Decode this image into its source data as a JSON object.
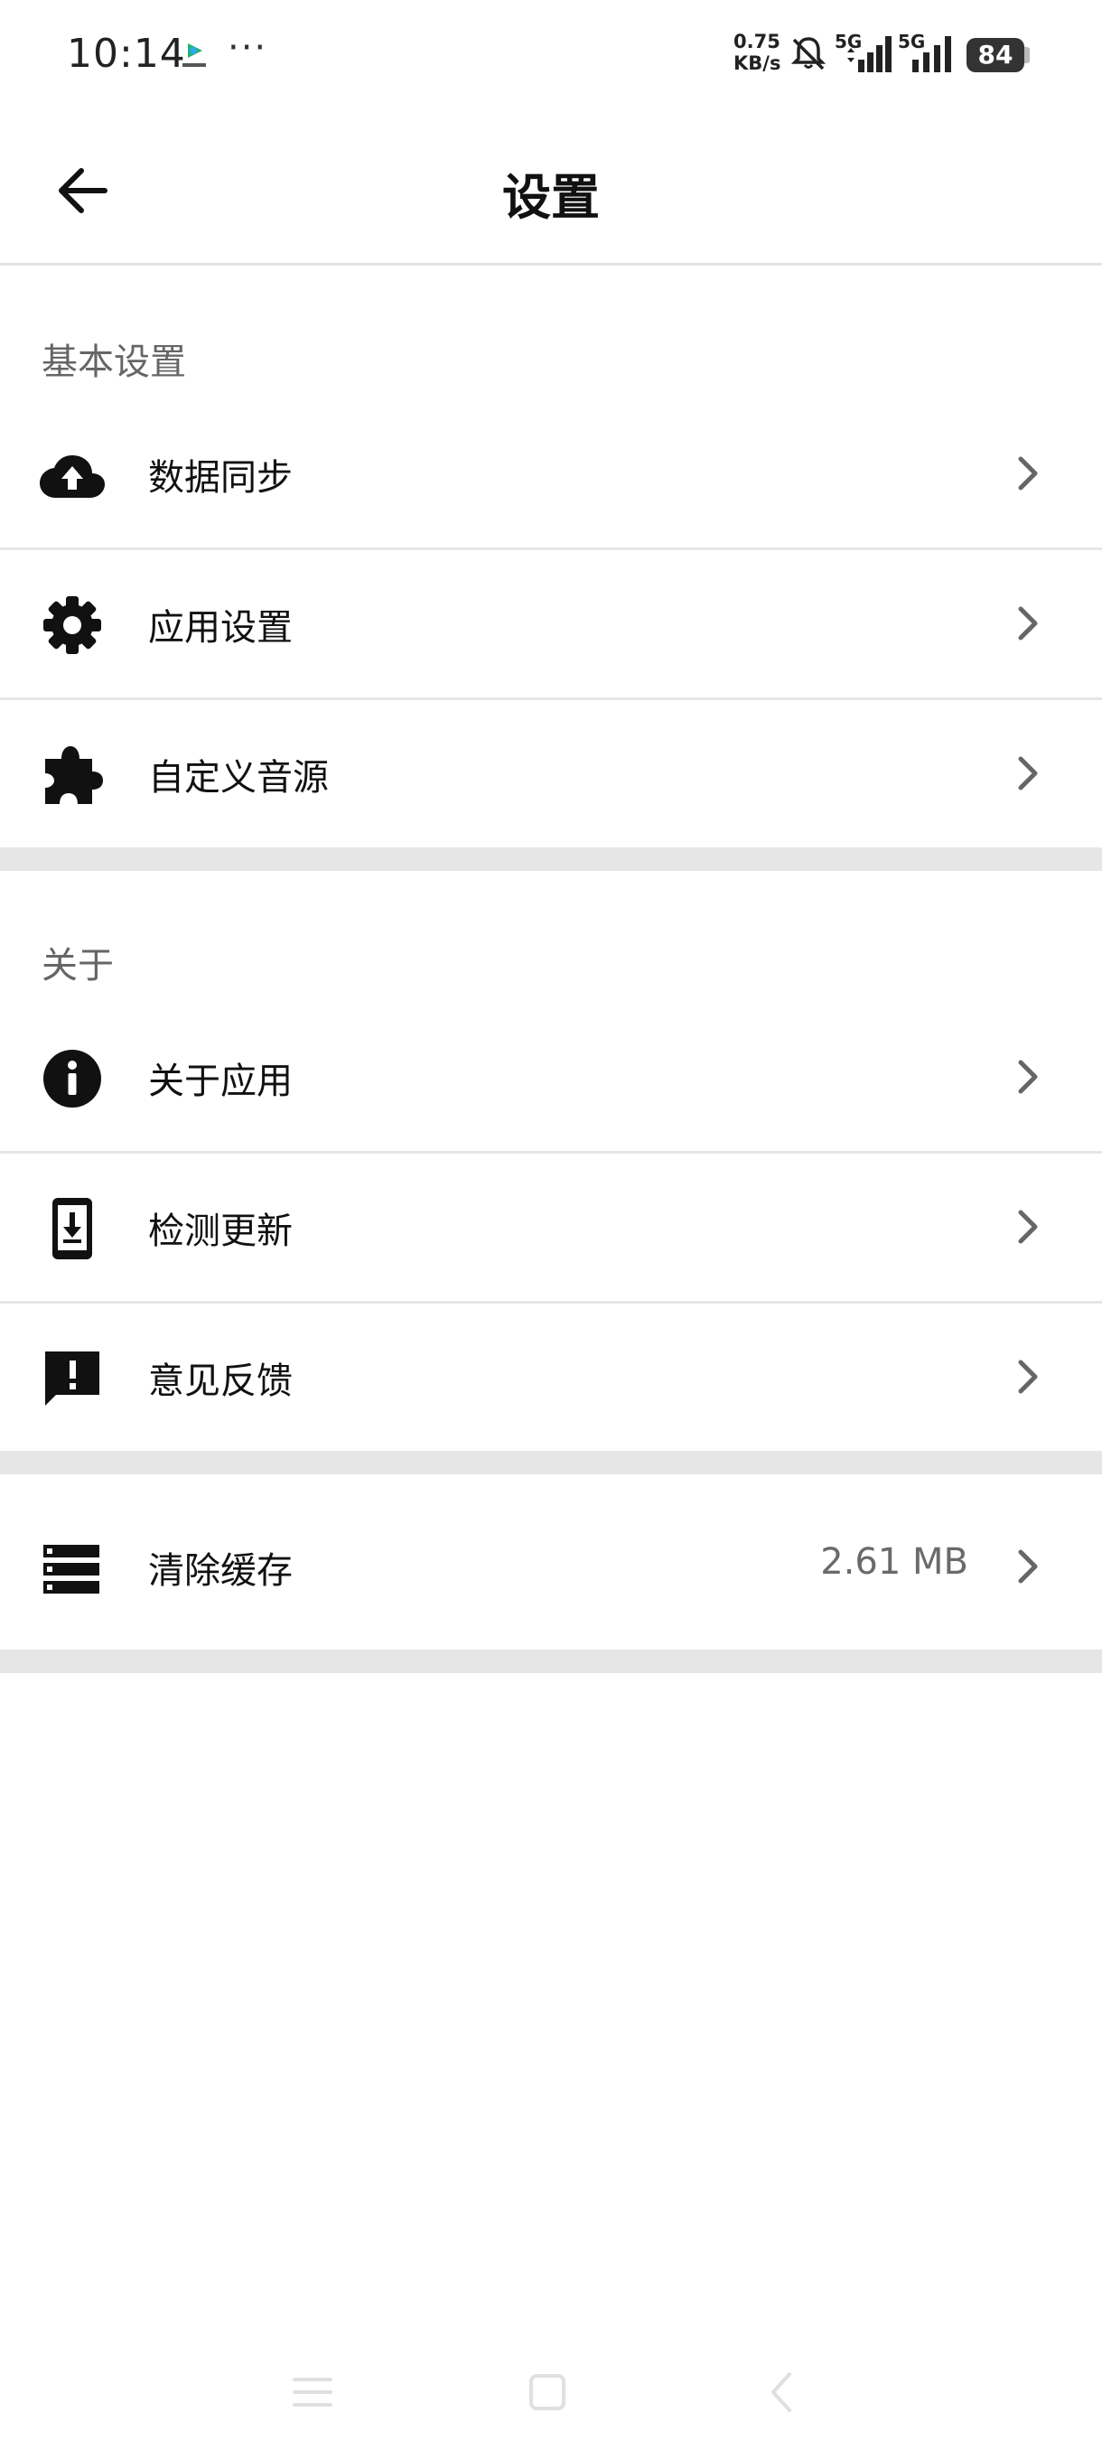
{
  "status_bar": {
    "time": "10:14",
    "more": "···",
    "net_speed_value": "0.75",
    "net_speed_unit": "KB/s",
    "signal1_label": "5G",
    "signal2_label": "5G",
    "battery": "84",
    "icons": [
      "app-notification-icon",
      "bell-muted-icon",
      "signal-icon",
      "signal-icon",
      "battery-icon"
    ]
  },
  "header": {
    "title": "设置",
    "back_icon": "arrow-left-icon"
  },
  "sections": {
    "basic": {
      "label": "基本设置",
      "items": [
        {
          "label": "数据同步",
          "icon": "cloud-upload-icon"
        },
        {
          "label": "应用设置",
          "icon": "gear-icon"
        },
        {
          "label": "自定义音源",
          "icon": "puzzle-icon"
        }
      ]
    },
    "about": {
      "label": "关于",
      "items": [
        {
          "label": "关于应用",
          "icon": "info-icon"
        },
        {
          "label": "检测更新",
          "icon": "phone-download-icon"
        },
        {
          "label": "意见反馈",
          "icon": "feedback-icon"
        }
      ]
    },
    "cache": {
      "items": [
        {
          "label": "清除缓存",
          "icon": "storage-icon",
          "value": "2.61 MB"
        }
      ]
    }
  },
  "nav_bar": {
    "icons": [
      "menu-icon",
      "home-icon",
      "back-icon"
    ]
  },
  "colors": {
    "text_primary": "#111111",
    "text_secondary": "#666666",
    "divider": "#e6e6e6",
    "chevron": "#666666"
  }
}
